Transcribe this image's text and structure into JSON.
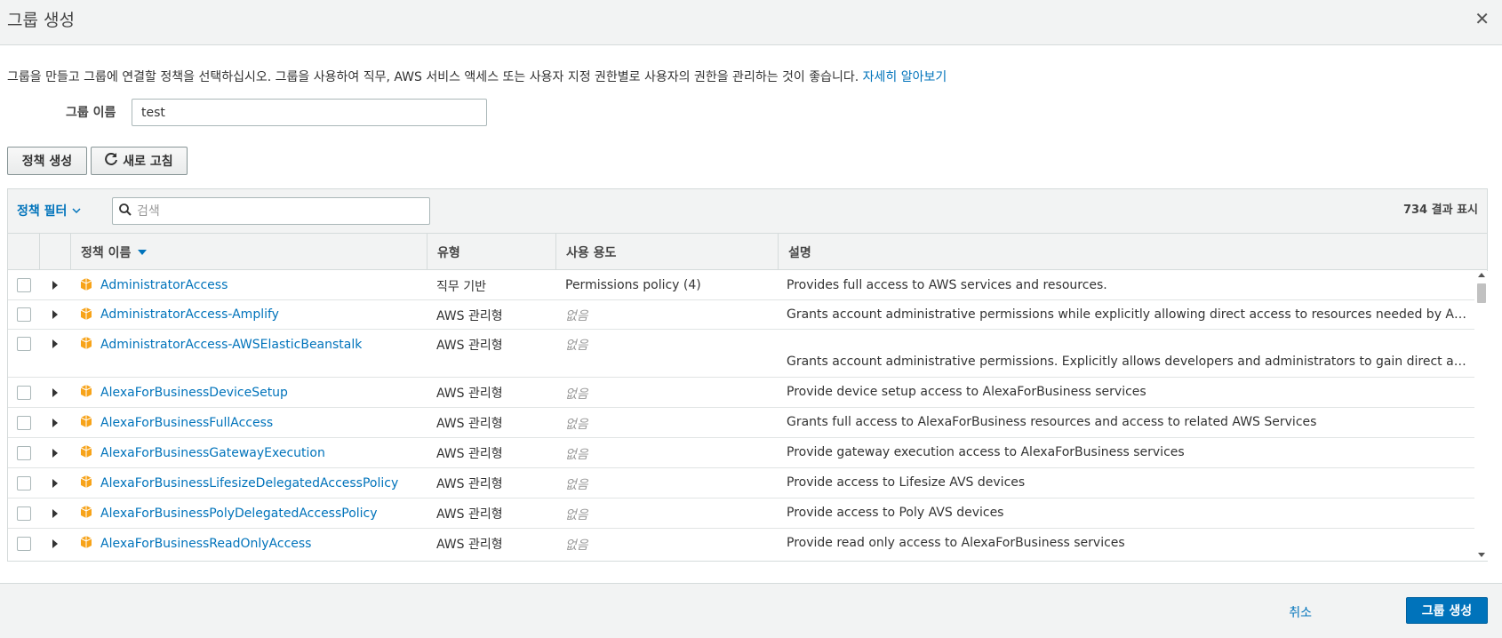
{
  "modal": {
    "title": "그룹 생성",
    "close_icon": "close-icon"
  },
  "intro": {
    "text": "그룹을 만들고 그룹에 연결할 정책을 선택하십시오. 그룹을 사용하여 직무, AWS 서비스 액세스 또는 사용자 지정 권한별로 사용자의 권한을 관리하는 것이 좋습니다.",
    "link": "자세히 알아보기"
  },
  "group_name": {
    "label": "그룹 이름",
    "value": "test"
  },
  "toolbar": {
    "create_policy": "정책 생성",
    "refresh": "새로 고침"
  },
  "filter": {
    "label": "정책 필터",
    "search_placeholder": "검색",
    "result_count": "734 결과 표시"
  },
  "table": {
    "columns": {
      "name": "정책 이름",
      "type": "유형",
      "usage": "사용 용도",
      "description": "설명"
    },
    "rows": [
      {
        "name": "AdministratorAccess",
        "type": "직무 기반",
        "usage": "Permissions policy (4)",
        "description": "Provides full access to AWS services and resources."
      },
      {
        "name": "AdministratorAccess-Amplify",
        "type": "AWS 관리형",
        "usage": "없음",
        "description": "Grants account administrative permissions while explicitly allowing direct access to resources needed by Amplify applications."
      },
      {
        "name": "AdministratorAccess-AWSElasticBeanstalk",
        "type": "AWS 관리형",
        "usage": "없음",
        "description": "Grants account administrative permissions. Explicitly allows developers and administrators to gain direct access to resources."
      },
      {
        "name": "AlexaForBusinessDeviceSetup",
        "type": "AWS 관리형",
        "usage": "없음",
        "description": "Provide device setup access to AlexaForBusiness services"
      },
      {
        "name": "AlexaForBusinessFullAccess",
        "type": "AWS 관리형",
        "usage": "없음",
        "description": "Grants full access to AlexaForBusiness resources and access to related AWS Services"
      },
      {
        "name": "AlexaForBusinessGatewayExecution",
        "type": "AWS 관리형",
        "usage": "없음",
        "description": "Provide gateway execution access to AlexaForBusiness services"
      },
      {
        "name": "AlexaForBusinessLifesizeDelegatedAccessPolicy",
        "type": "AWS 관리형",
        "usage": "없음",
        "description": "Provide access to Lifesize AVS devices"
      },
      {
        "name": "AlexaForBusinessPolyDelegatedAccessPolicy",
        "type": "AWS 관리형",
        "usage": "없음",
        "description": "Provide access to Poly AVS devices"
      },
      {
        "name": "AlexaForBusinessReadOnlyAccess",
        "type": "AWS 관리형",
        "usage": "없음",
        "description": "Provide read only access to AlexaForBusiness services"
      }
    ]
  },
  "footer": {
    "cancel": "취소",
    "submit": "그룹 생성"
  },
  "colors": {
    "link": "#0073bb",
    "policy_icon": "#f7a319",
    "primary": "#0073bb"
  }
}
